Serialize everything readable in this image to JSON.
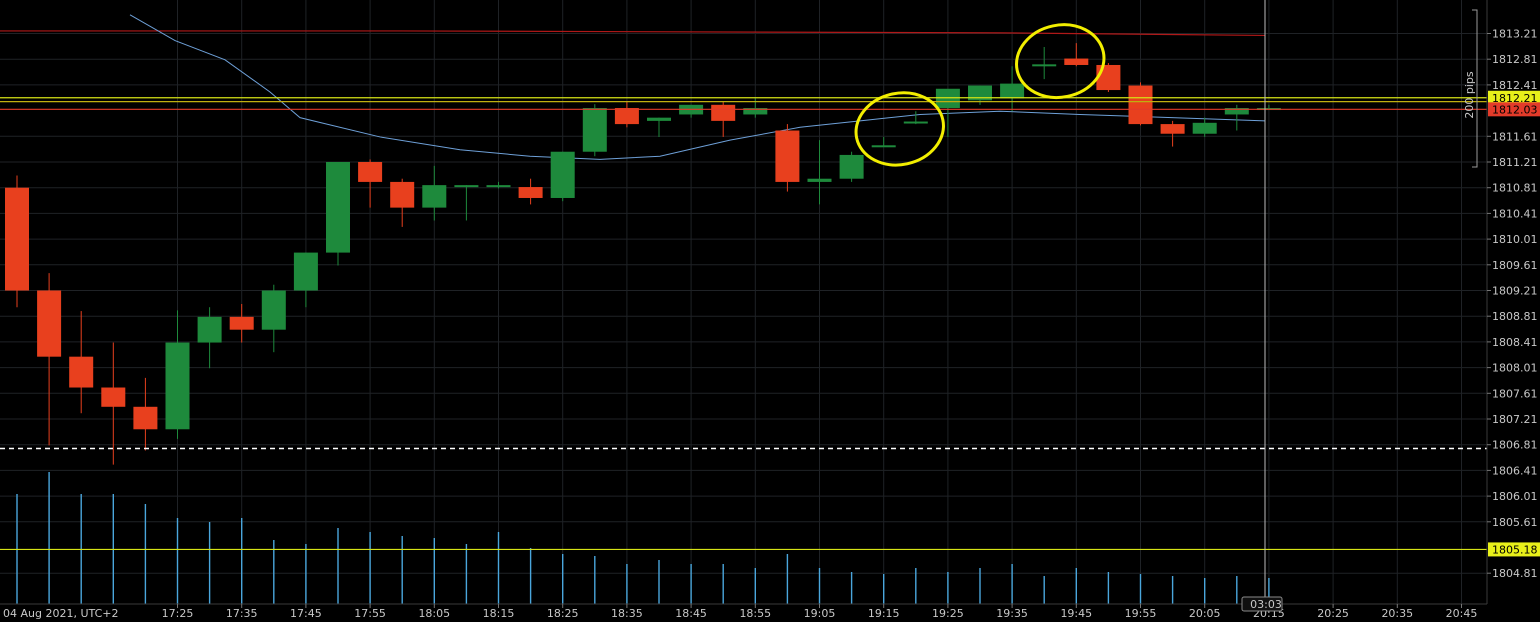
{
  "chart_data": {
    "type": "candlestick",
    "date_label": "04 Aug 2021, UTC+2",
    "x_tick_labels": [
      "17:25",
      "17:35",
      "17:45",
      "17:55",
      "18:05",
      "18:15",
      "18:25",
      "18:35",
      "18:45",
      "18:55",
      "19:05",
      "19:15",
      "19:25",
      "19:35",
      "19:45",
      "19:55",
      "20:05",
      "20:15",
      "20:25",
      "20:35",
      "20:45"
    ],
    "y_tick_labels": [
      "1813.21",
      "1812.81",
      "1812.41",
      "1811.61",
      "1811.21",
      "1810.81",
      "1810.41",
      "1810.01",
      "1809.61",
      "1809.21",
      "1808.81",
      "1808.41",
      "1808.01",
      "1807.61",
      "1807.21",
      "1806.81",
      "1806.41",
      "1806.01",
      "1805.61",
      "1804.81"
    ],
    "y_range": [
      1804.5,
      1813.5
    ],
    "grid": true,
    "bar_interval_minutes": 5,
    "first_bar_time": "17:00",
    "candles": [
      {
        "time": "17:00",
        "open": 1810.81,
        "high": 1811.0,
        "close": 1809.21,
        "low": 1808.95
      },
      {
        "time": "17:05",
        "open": 1809.21,
        "high": 1809.48,
        "close": 1808.18,
        "low": 1806.8
      },
      {
        "time": "17:10",
        "open": 1808.18,
        "high": 1808.89,
        "close": 1807.7,
        "low": 1807.3
      },
      {
        "time": "17:15",
        "open": 1807.7,
        "high": 1808.4,
        "close": 1807.4,
        "low": 1806.5
      },
      {
        "time": "17:20",
        "open": 1807.4,
        "high": 1807.85,
        "close": 1807.05,
        "low": 1806.72
      },
      {
        "time": "17:25",
        "open": 1807.05,
        "high": 1808.9,
        "close": 1808.4,
        "low": 1806.9
      },
      {
        "time": "17:30",
        "open": 1808.4,
        "high": 1808.95,
        "close": 1808.8,
        "low": 1808.0
      },
      {
        "time": "17:35",
        "open": 1808.8,
        "high": 1809.0,
        "close": 1808.6,
        "low": 1808.4
      },
      {
        "time": "17:40",
        "open": 1808.6,
        "high": 1809.3,
        "close": 1809.21,
        "low": 1808.25
      },
      {
        "time": "17:45",
        "open": 1809.21,
        "high": 1809.8,
        "close": 1809.8,
        "low": 1808.95
      },
      {
        "time": "17:50",
        "open": 1809.8,
        "high": 1811.21,
        "close": 1811.21,
        "low": 1809.6
      },
      {
        "time": "17:55",
        "open": 1811.21,
        "high": 1811.25,
        "close": 1810.9,
        "low": 1810.5
      },
      {
        "time": "18:00",
        "open": 1810.9,
        "high": 1810.95,
        "close": 1810.5,
        "low": 1810.2
      },
      {
        "time": "18:05",
        "open": 1810.5,
        "high": 1811.15,
        "close": 1810.85,
        "low": 1810.3
      },
      {
        "time": "18:10",
        "open": 1810.82,
        "high": 1810.85,
        "close": 1810.85,
        "low": 1810.3
      },
      {
        "time": "18:15",
        "open": 1810.82,
        "high": 1810.9,
        "close": 1810.85,
        "low": 1810.8
      },
      {
        "time": "18:20",
        "open": 1810.82,
        "high": 1810.95,
        "close": 1810.65,
        "low": 1810.55
      },
      {
        "time": "18:25",
        "open": 1810.65,
        "high": 1811.37,
        "close": 1811.37,
        "low": 1810.6
      },
      {
        "time": "18:30",
        "open": 1811.37,
        "high": 1812.11,
        "close": 1812.05,
        "low": 1811.3
      },
      {
        "time": "18:35",
        "open": 1812.05,
        "high": 1812.15,
        "close": 1811.8,
        "low": 1811.75
      },
      {
        "time": "18:40",
        "open": 1811.85,
        "high": 1811.9,
        "close": 1811.9,
        "low": 1811.6
      },
      {
        "time": "18:45",
        "open": 1811.95,
        "high": 1812.1,
        "close": 1812.1,
        "low": 1811.9
      },
      {
        "time": "18:50",
        "open": 1812.1,
        "high": 1812.15,
        "close": 1811.85,
        "low": 1811.6
      },
      {
        "time": "18:55",
        "open": 1811.95,
        "high": 1812.2,
        "close": 1812.05,
        "low": 1811.9
      },
      {
        "time": "19:00",
        "open": 1811.7,
        "high": 1811.8,
        "close": 1810.9,
        "low": 1810.75
      },
      {
        "time": "19:05",
        "open": 1810.9,
        "high": 1811.55,
        "close": 1810.95,
        "low": 1810.55
      },
      {
        "time": "19:10",
        "open": 1810.95,
        "high": 1811.37,
        "close": 1811.32,
        "low": 1810.9
      },
      {
        "time": "19:15",
        "open": 1811.45,
        "high": 1811.6,
        "close": 1811.47,
        "low": 1811.45
      },
      {
        "time": "19:20",
        "open": 1811.82,
        "high": 1812.0,
        "close": 1811.84,
        "low": 1811.8
      },
      {
        "time": "19:25",
        "open": 1812.05,
        "high": 1812.25,
        "close": 1812.35,
        "low": 1811.6
      },
      {
        "time": "19:30",
        "open": 1812.17,
        "high": 1812.4,
        "close": 1812.4,
        "low": 1812.1
      },
      {
        "time": "19:35",
        "open": 1812.2,
        "high": 1812.7,
        "close": 1812.43,
        "low": 1812.0
      },
      {
        "time": "19:40",
        "open": 1812.7,
        "high": 1813.0,
        "close": 1812.73,
        "low": 1812.5
      },
      {
        "time": "19:45",
        "open": 1812.82,
        "high": 1813.06,
        "close": 1812.72,
        "low": 1812.7
      },
      {
        "time": "19:50",
        "open": 1812.72,
        "high": 1812.75,
        "close": 1812.33,
        "low": 1812.3
      },
      {
        "time": "19:55",
        "open": 1812.4,
        "high": 1812.45,
        "close": 1811.8,
        "low": 1811.78
      },
      {
        "time": "20:00",
        "open": 1811.8,
        "high": 1811.85,
        "close": 1811.65,
        "low": 1811.45
      },
      {
        "time": "20:05",
        "open": 1811.65,
        "high": 1811.9,
        "close": 1811.82,
        "low": 1811.6
      },
      {
        "time": "20:10",
        "open": 1811.95,
        "high": 1812.1,
        "close": 1812.05,
        "low": 1811.7
      },
      {
        "time": "20:15",
        "open": 1812.05,
        "high": 1812.1,
        "close": 1812.05,
        "low": 1812.02
      }
    ],
    "moving_average_slow": {
      "color": "#b01818",
      "values": [
        1813.25,
        1813.25,
        1813.22,
        1813.18
      ]
    },
    "moving_average_fast": {
      "color": "#6ea0d8",
      "values": [
        1813.5,
        1813.1,
        1812.8,
        1812.3,
        1811.9,
        1811.6,
        1811.4,
        1811.3,
        1811.25,
        1811.3,
        1811.55,
        1811.75,
        1811.85,
        1811.95,
        1812.0,
        1811.95,
        1811.85
      ]
    },
    "volume_values": [
      55,
      66,
      55,
      55,
      50,
      43,
      41,
      43,
      32,
      30,
      38,
      36,
      34,
      33,
      30,
      36,
      28,
      25,
      24,
      20,
      22,
      20,
      20,
      18,
      25,
      18,
      16,
      15,
      18,
      16,
      18,
      20,
      14,
      18,
      16,
      15,
      14,
      13,
      14,
      13
    ],
    "horizontal_lines": [
      {
        "price": 1812.21,
        "color": "#d6e316",
        "label": "1812.21",
        "label_bg": "#e8f01a",
        "label_fg": "#000000"
      },
      {
        "price": 1812.15,
        "color": "#bfae10"
      },
      {
        "price": 1812.03,
        "color": "#e23b2a",
        "label": "1812.03",
        "label_bg": "#e33b2a",
        "label_fg": "#000000"
      },
      {
        "price": 1805.18,
        "color": "#d6e316",
        "label": "1805.18",
        "label_bg": "#e8f01a",
        "label_fg": "#000000"
      },
      {
        "price": 1806.75,
        "color": "#ffffff",
        "style": "dashed"
      }
    ],
    "range_marker_label": "200 pips",
    "crosshair_time_label": "03:03",
    "annotations": [
      {
        "shape": "ellipse",
        "color": "#f2ee00",
        "around_bars": [
          "19:15",
          "19:20"
        ]
      },
      {
        "shape": "ellipse",
        "color": "#f2ee00",
        "around_bars": [
          "19:40",
          "19:45"
        ]
      }
    ],
    "colors": {
      "background": "#000000",
      "grid": "#1f2226",
      "bull": "#1e8a3c",
      "bear": "#e8401e",
      "volume": "#4aa6dc"
    }
  }
}
